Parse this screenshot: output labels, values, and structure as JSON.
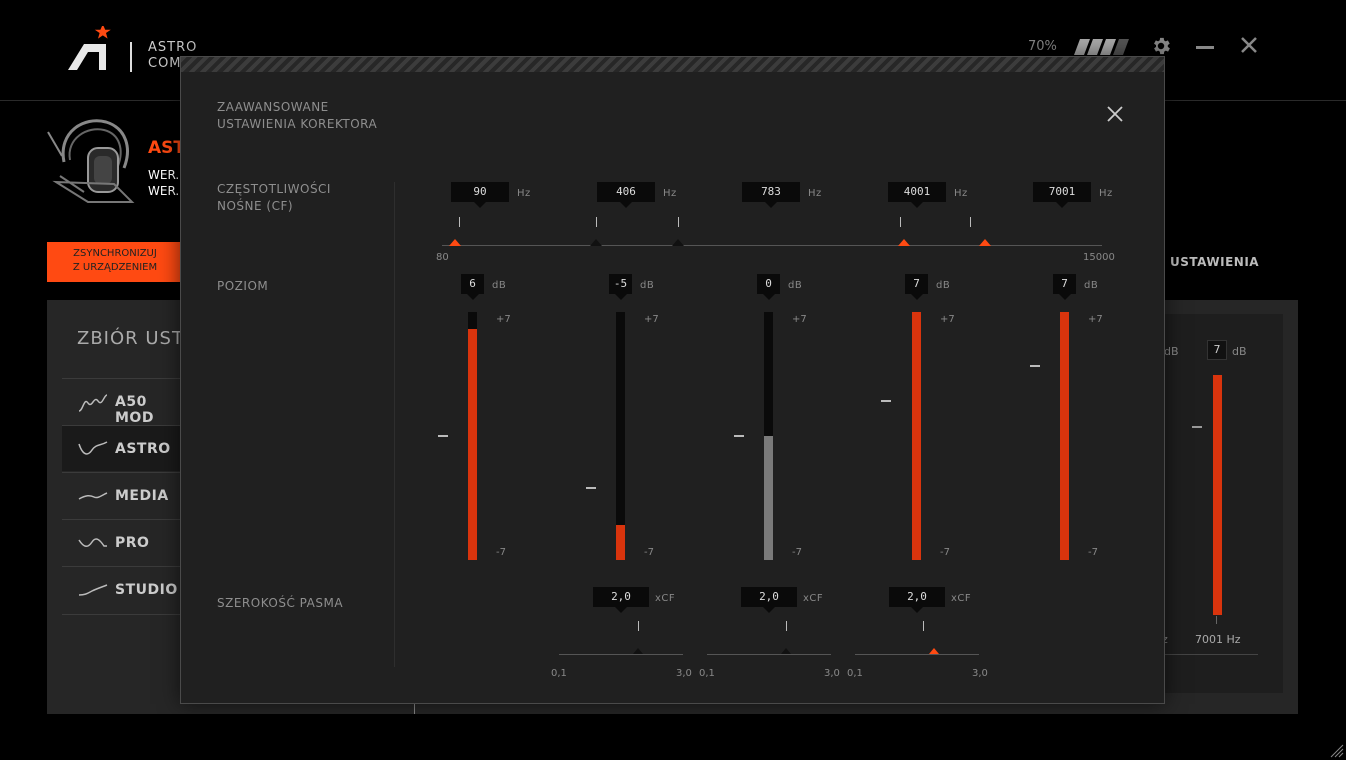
{
  "header": {
    "brand_line1": "ASTRO",
    "brand_line2": "COMM",
    "battery": "70%"
  },
  "device": {
    "name": "AST",
    "ver1": "WER.",
    "ver2": "WER."
  },
  "sync_button": {
    "line1": "ZSYNCHRONIZUJ",
    "line2": "Z URZĄDZENIEM"
  },
  "settings_tab": "USTAWIENIA",
  "presets": {
    "title": "ZBIÓR USTA",
    "items": [
      {
        "label": "A50 MOD",
        "active": false
      },
      {
        "label": "ASTRO",
        "active": true
      },
      {
        "label": "MEDIA",
        "active": false
      },
      {
        "label": "PRO",
        "active": false
      },
      {
        "label": "STUDIO",
        "active": false
      }
    ]
  },
  "background_eq": {
    "unit_db": "dB",
    "band5_value": "7",
    "band5_freq": "7001 Hz",
    "partial_freq": "z"
  },
  "modal": {
    "title_line1": "ZAAWANSOWANE",
    "title_line2": "USTAWIENIA KOREKTORA",
    "freq_label_line1": "CZĘSTOTLIWOŚCI",
    "freq_label_line2": "NOŚNE (CF)",
    "level_label": "POZIOM",
    "bandwidth_label": "SZEROKOŚĆ PASMA",
    "freq_unit": "Hz",
    "level_unit": "dB",
    "bw_unit": "xCF",
    "freq_min": "80",
    "freq_max": "15000",
    "level_max": "+7",
    "level_min": "-7",
    "bw_min": "0,1",
    "bw_max": "3,0",
    "bands": [
      {
        "freq": "90",
        "level": "6",
        "level_value": 6
      },
      {
        "freq": "406",
        "level": "-5",
        "level_value": -5,
        "bandwidth": "2,0"
      },
      {
        "freq": "783",
        "level": "0",
        "level_value": 0,
        "bandwidth": "2,0"
      },
      {
        "freq": "4001",
        "level": "7",
        "level_value": 7,
        "bandwidth": "2,0"
      },
      {
        "freq": "7001",
        "level": "7",
        "level_value": 7
      }
    ]
  }
}
